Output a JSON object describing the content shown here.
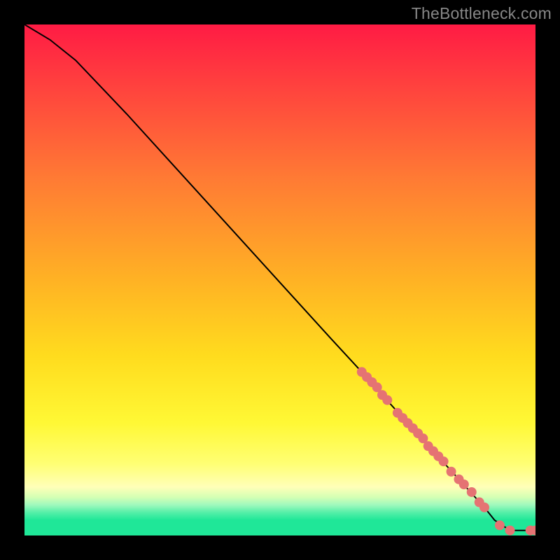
{
  "watermark": "TheBottleneck.com",
  "chart_data": {
    "type": "line",
    "title": "",
    "xlabel": "",
    "ylabel": "",
    "xlim": [
      0,
      100
    ],
    "ylim": [
      0,
      100
    ],
    "grid": false,
    "series": [
      {
        "name": "curve",
        "x": [
          0,
          5,
          10,
          20,
          30,
          40,
          50,
          60,
          66,
          70,
          75,
          80,
          85,
          90,
          92,
          95,
          100
        ],
        "y": [
          100,
          97,
          93,
          82.5,
          71.5,
          60.5,
          49.5,
          38.5,
          32,
          27.5,
          22,
          16.5,
          11,
          5.5,
          3,
          1,
          1
        ]
      }
    ],
    "markers": [
      {
        "x": 66,
        "y": 32
      },
      {
        "x": 67,
        "y": 31
      },
      {
        "x": 68,
        "y": 30
      },
      {
        "x": 69,
        "y": 29
      },
      {
        "x": 70,
        "y": 27.5
      },
      {
        "x": 71,
        "y": 26.5
      },
      {
        "x": 73,
        "y": 24
      },
      {
        "x": 74,
        "y": 23
      },
      {
        "x": 75,
        "y": 22
      },
      {
        "x": 76,
        "y": 21
      },
      {
        "x": 77,
        "y": 20
      },
      {
        "x": 78,
        "y": 19
      },
      {
        "x": 79,
        "y": 17.5
      },
      {
        "x": 80,
        "y": 16.5
      },
      {
        "x": 81,
        "y": 15.5
      },
      {
        "x": 82,
        "y": 14.5
      },
      {
        "x": 83.5,
        "y": 12.5
      },
      {
        "x": 85,
        "y": 11
      },
      {
        "x": 86,
        "y": 10
      },
      {
        "x": 87.5,
        "y": 8.5
      },
      {
        "x": 89,
        "y": 6.5
      },
      {
        "x": 90,
        "y": 5.5
      },
      {
        "x": 93,
        "y": 2
      },
      {
        "x": 95,
        "y": 1
      },
      {
        "x": 99,
        "y": 1
      },
      {
        "x": 100,
        "y": 1
      }
    ],
    "gradient_stops": [
      {
        "pos": 0.0,
        "color": "#ff1b44"
      },
      {
        "pos": 0.1,
        "color": "#ff3b3f"
      },
      {
        "pos": 0.3,
        "color": "#ff7a34"
      },
      {
        "pos": 0.5,
        "color": "#ffb224"
      },
      {
        "pos": 0.65,
        "color": "#ffdc1e"
      },
      {
        "pos": 0.78,
        "color": "#fff835"
      },
      {
        "pos": 0.86,
        "color": "#ffff74"
      },
      {
        "pos": 0.905,
        "color": "#ffffb8"
      },
      {
        "pos": 0.925,
        "color": "#d4ffb4"
      },
      {
        "pos": 0.94,
        "color": "#a0f9bd"
      },
      {
        "pos": 0.955,
        "color": "#55efa8"
      },
      {
        "pos": 0.97,
        "color": "#1fe798"
      },
      {
        "pos": 1.0,
        "color": "#1fe798"
      }
    ],
    "marker_color": "#e57373",
    "line_color": "#000000"
  }
}
